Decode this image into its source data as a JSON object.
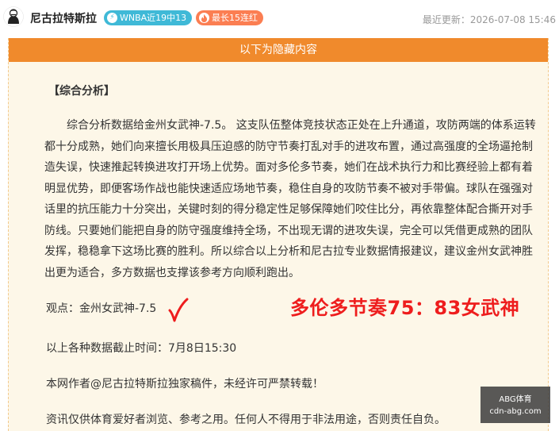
{
  "header": {
    "author": "尼古拉特斯拉",
    "badges": [
      {
        "label": "WNBA近19中13",
        "icon": "bolt-icon",
        "color": "#3fb9d7"
      },
      {
        "label": "最长15连红",
        "icon": "flame-icon",
        "color": "#fb7e52"
      }
    ],
    "last_update": "最近更新：2026-07-08 15:46"
  },
  "content": {
    "hidden_banner": "以下为隐藏内容",
    "section_title": "【综合分析】",
    "paragraph": "综合分析数据给金州女武神-7.5。 这支队伍整体竞技状态正处在上升通道，攻防两端的体系运转都十分成熟，她们向来擅长用极具压迫感的防守节奏打乱对手的进攻布置，通过高强度的全场逼抢制造失误，快速推起转换进攻打开场上优势。面对多伦多节奏，她们在战术执行力和比赛经验上都有着明显优势，即便客场作战也能快速适应场地节奏，稳住自身的攻防节奏不被对手带偏。球队在强强对话里的抗压能力十分突出，关键时刻的得分稳定性足够保障她们咬住比分，再依靠整体配合撕开对手防线。只要她们能把自身的防守强度维持全场，不出现无谓的进攻失误，完全可以凭借更成熟的团队发挥，稳稳拿下这场比赛的胜利。所以综合以上分析和尼古拉专业数据情报建议，建议金州女武神胜出更为适合，多方数据也支撑该参考方向顺利跑出。",
    "opinion": "观点：金州女武神-7.5",
    "result_mark": "√",
    "final_score": "多伦多节奏75：83女武神",
    "deadline": "以上各种数据截止时间：7月8日15:30",
    "copyright": "本网作者@尼古拉特斯拉独家稿件，未经许可严禁转载！",
    "disclaimer": "资讯仅供体育爱好者浏览、参考之用。任何人不得用于非法用途，否则责任自负。"
  },
  "watermark": {
    "line1": "ABG体育",
    "line2": "cdn-abg.com"
  },
  "colors": {
    "banner": "#f08a2c",
    "content_bg": "#fdf7e8",
    "highlight_red": "#ee1d1d"
  }
}
